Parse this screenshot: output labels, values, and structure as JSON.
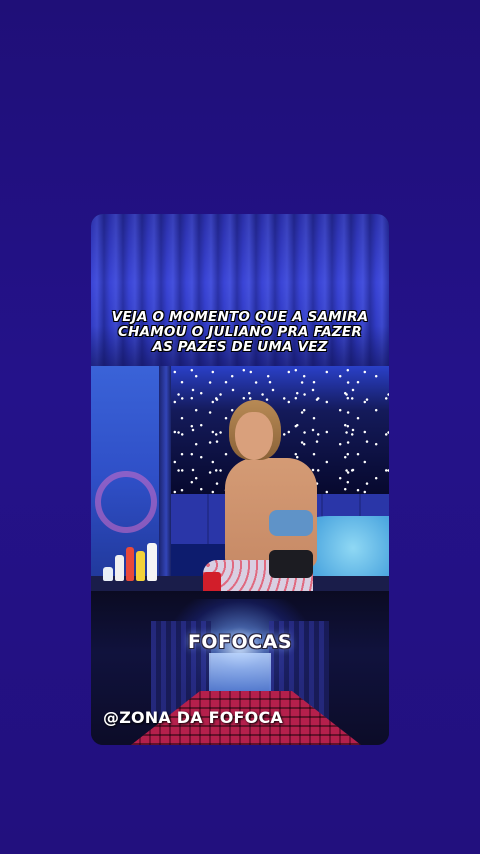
{
  "post": {
    "headline_lines": [
      "VEJA O MOMENTO QUE A SAMIRA",
      "CHAMOU O JULIANO PRA FAZER",
      "AS PAZES DE UMA VEZ"
    ]
  },
  "promo": {
    "logo_text": "FOFOCAS",
    "handle": "@ZONA DA FOFOCA"
  },
  "colors": {
    "background": "#22107c",
    "curtain": "#3a44d6",
    "headline_text": "#ffffff",
    "seat_red": "#b4204c"
  }
}
